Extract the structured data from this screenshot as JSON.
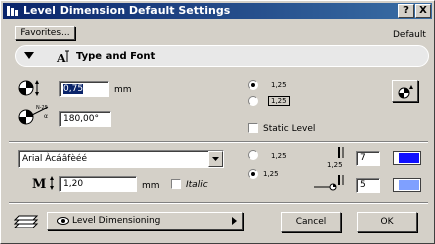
{
  "window": {
    "title": "Level Dimension Default Settings",
    "help_button": "?",
    "close_button": "X"
  },
  "header": {
    "favorites_label": "Favorites...",
    "default_label": "Default"
  },
  "panel": {
    "title": "Type and Font"
  },
  "type_section": {
    "height_value": "0,75",
    "height_unit": "mm",
    "angle_value": "180,00°",
    "angle_icon_tag": "N-25",
    "radio_top_label": "1,25",
    "radio_bottom_label": "1,25",
    "radio_top_selected": true,
    "static_level_label": "Static Level",
    "marker_button_icon": "marker-settings-icon"
  },
  "font_section": {
    "font_value": "Arial Àcáâfèéé",
    "size_value": "1,20",
    "size_unit": "mm",
    "italic_label": "Italic",
    "radio_top_label": "1,25",
    "radio_bottom_label": "1,25",
    "radio_bottom_selected": true,
    "pen_label": "1,25",
    "pen_top_value": "7",
    "pen_bottom_value": "5",
    "pen_top_color": "#1010ff",
    "pen_bottom_color": "#7fa0ff"
  },
  "footer": {
    "layer_value": "Level Dimensioning",
    "cancel_label": "Cancel",
    "ok_label": "OK"
  }
}
